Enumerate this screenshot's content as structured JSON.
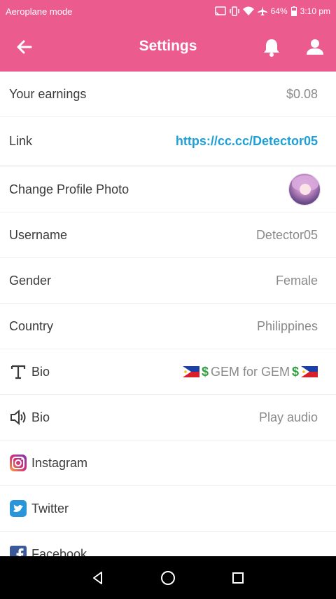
{
  "status_bar": {
    "left_text": "Aeroplane mode",
    "battery": "64%",
    "time": "3:10 pm"
  },
  "header": {
    "title": "Settings"
  },
  "rows": [
    {
      "label": "Your earnings",
      "value": "$0.08"
    },
    {
      "label": "Link",
      "value": "https://cc.cc/Detector05"
    },
    {
      "label": "Change Profile Photo"
    },
    {
      "label": "Username",
      "value": "Detector05"
    },
    {
      "label": "Gender",
      "value": "Female"
    },
    {
      "label": "Country",
      "value": "Philippines"
    },
    {
      "label": "Bio",
      "value_text": "GEM for GEM",
      "value_symbol": "$",
      "icon": "text-format-icon"
    },
    {
      "label": "Bio",
      "value": "Play audio",
      "icon": "speaker-icon"
    },
    {
      "label": "Instagram",
      "icon": "instagram-icon"
    },
    {
      "label": "Twitter",
      "icon": "twitter-icon"
    },
    {
      "label": "Facebook",
      "icon": "facebook-icon"
    }
  ],
  "colors": {
    "primary": "#ec5b8d",
    "link": "#1e9fd6"
  }
}
